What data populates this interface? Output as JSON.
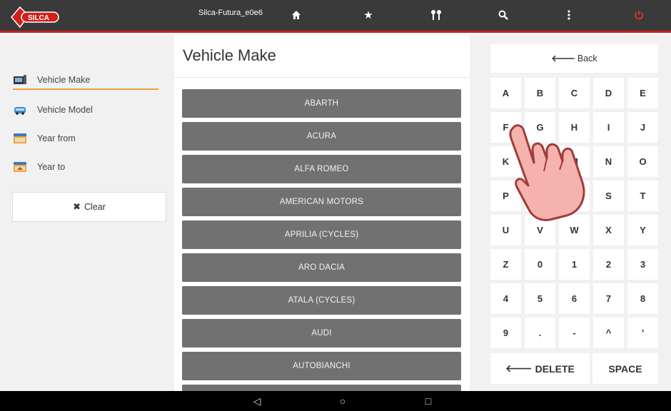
{
  "topbar": {
    "device_name": "Silca-Futura_e0e6",
    "brand": "SILCA",
    "icons": [
      "home-icon",
      "star-icon",
      "keys-icon",
      "search-icon",
      "more-icon",
      "power-icon"
    ],
    "accent": "#d0201a"
  },
  "sidebar": {
    "items": [
      {
        "label": "Vehicle Make",
        "icon": "vehicle-make-icon",
        "active": true
      },
      {
        "label": "Vehicle Model",
        "icon": "car-icon",
        "active": false
      },
      {
        "label": "Year from",
        "icon": "calendar-icon",
        "active": false
      },
      {
        "label": "Year to",
        "icon": "calendar-icon",
        "active": false
      }
    ],
    "clear_label": "Clear"
  },
  "main": {
    "title": "Vehicle Make",
    "makes": [
      "ABARTH",
      "ACURA",
      "ALFA ROMEO",
      "AMERICAN MOTORS",
      "APRILIA (CYCLES)",
      "ARO DACIA",
      "ATALA (CYCLES)",
      "AUDI",
      "AUTOBIANCHI",
      ""
    ]
  },
  "keyboard": {
    "back_label": "Back",
    "keys": [
      "A",
      "B",
      "C",
      "D",
      "E",
      "F",
      "G",
      "H",
      "I",
      "J",
      "K",
      "L",
      "M",
      "N",
      "O",
      "P",
      "Q",
      "R",
      "S",
      "T",
      "U",
      "V",
      "W",
      "X",
      "Y",
      "Z",
      "0",
      "1",
      "2",
      "3",
      "4",
      "5",
      "6",
      "7",
      "8",
      "9",
      ".",
      "-",
      "^",
      "'"
    ],
    "delete_label": "DELETE",
    "space_label": "SPACE"
  },
  "navbar": {
    "back": "◁",
    "home": "○",
    "recents": "□"
  }
}
